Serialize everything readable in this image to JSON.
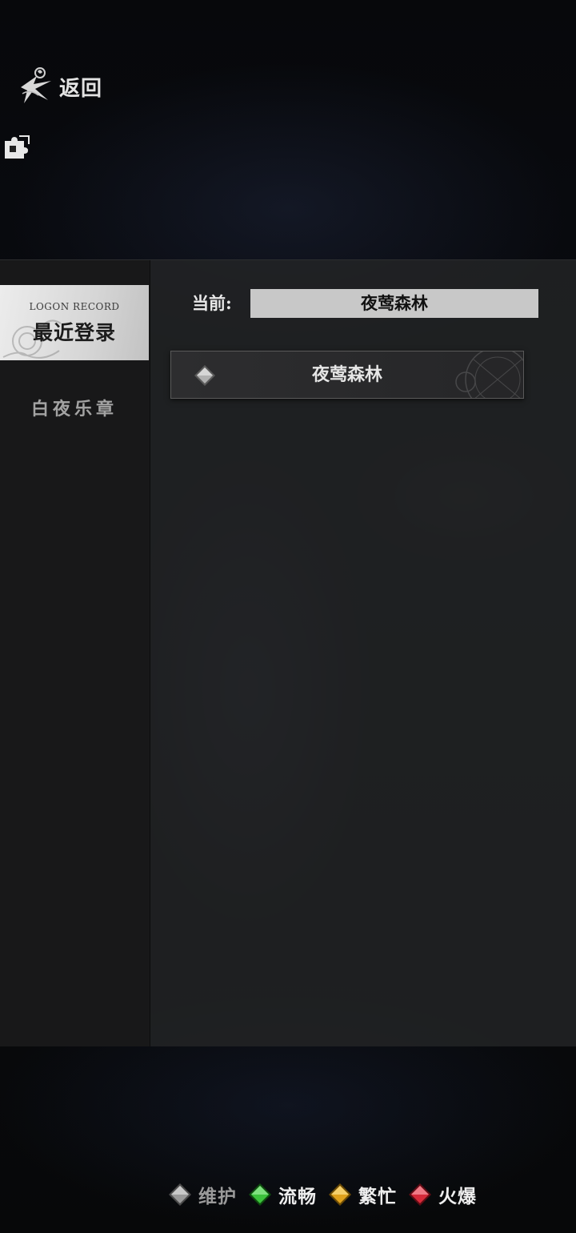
{
  "header": {
    "back_label": "返回"
  },
  "sidebar": {
    "active_tab": {
      "subtitle": "LOGON RECORD",
      "title": "最近登录"
    },
    "tabs": [
      {
        "label": "白夜乐章"
      }
    ]
  },
  "main": {
    "current_label": "当前:",
    "current_value": "夜莺森林",
    "servers": [
      {
        "name": "夜莺森林",
        "status": "维护"
      }
    ]
  },
  "legend": [
    {
      "label": "维护",
      "color": "#9a9a9a",
      "text_color": "#9a9a9a"
    },
    {
      "label": "流畅",
      "color": "#3cc23c",
      "text_color": "#eeeeee"
    },
    {
      "label": "繁忙",
      "color": "#e0a21c",
      "text_color": "#eeeeee"
    },
    {
      "label": "火爆",
      "color": "#d62a3a",
      "text_color": "#eeeeee"
    }
  ]
}
